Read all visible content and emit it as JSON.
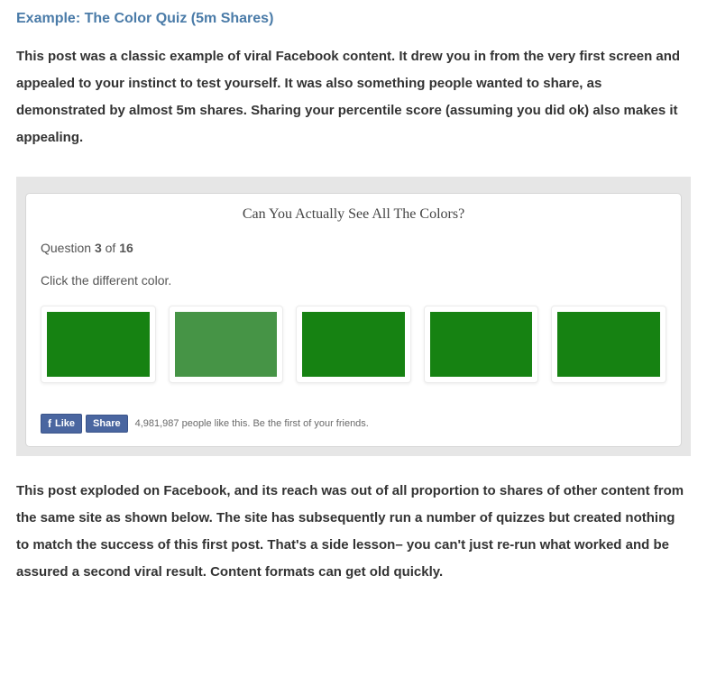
{
  "heading": "Example: The Color Quiz (5m Shares)",
  "paragraph1": "This post was a classic example of viral Facebook content. It drew you in from the very first screen and appealed to your instinct to test yourself. It was also something people wanted to share, as demonstrated by almost 5m shares. Sharing your percentile score (assuming you did ok) also makes it appealing.",
  "paragraph2": "This post exploded on Facebook, and its reach was out of all proportion to shares of other content from the same site as shown below. The site has subsequently run a number of quizzes but created nothing to match the success of this first post. That's a side lesson– you can't just re-run what worked and be assured a second viral result. Content formats can get old quickly.",
  "quiz": {
    "title": "Can You Actually See All The Colors?",
    "question_prefix": "Question ",
    "question_current": "3",
    "question_of": " of ",
    "question_total": "16",
    "instruction": "Click the different color.",
    "swatches": [
      {
        "color": "#168212"
      },
      {
        "color": "#469446"
      },
      {
        "color": "#168212"
      },
      {
        "color": "#168212"
      },
      {
        "color": "#168212"
      }
    ]
  },
  "facebook": {
    "like_label": "Like",
    "share_label": "Share",
    "count_text": "4,981,987 people like this. Be the first of your friends."
  }
}
